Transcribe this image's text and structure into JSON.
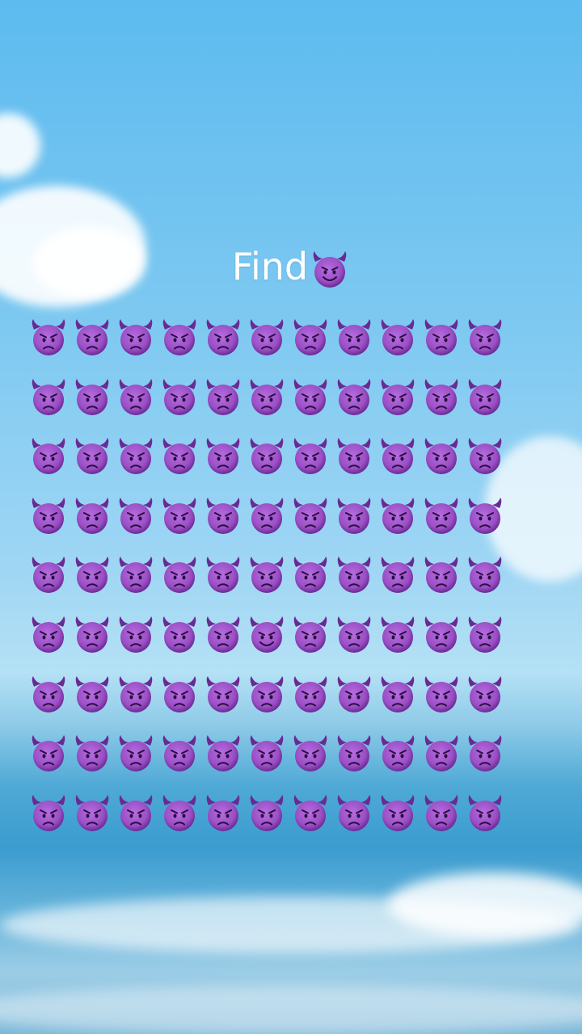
{
  "title": {
    "text": "Find",
    "target_icon": "smiling-devil-icon"
  },
  "puzzle": {
    "rows": 9,
    "cols": 11,
    "common_icon": "angry-devil-icon",
    "odd_icon": "smiling-devil-icon",
    "odd_position": {
      "row": 5,
      "col": 5
    }
  },
  "colors": {
    "devil_purple": "#9b4fc5",
    "devil_dark": "#6a2a94",
    "text": "#ffffff"
  }
}
